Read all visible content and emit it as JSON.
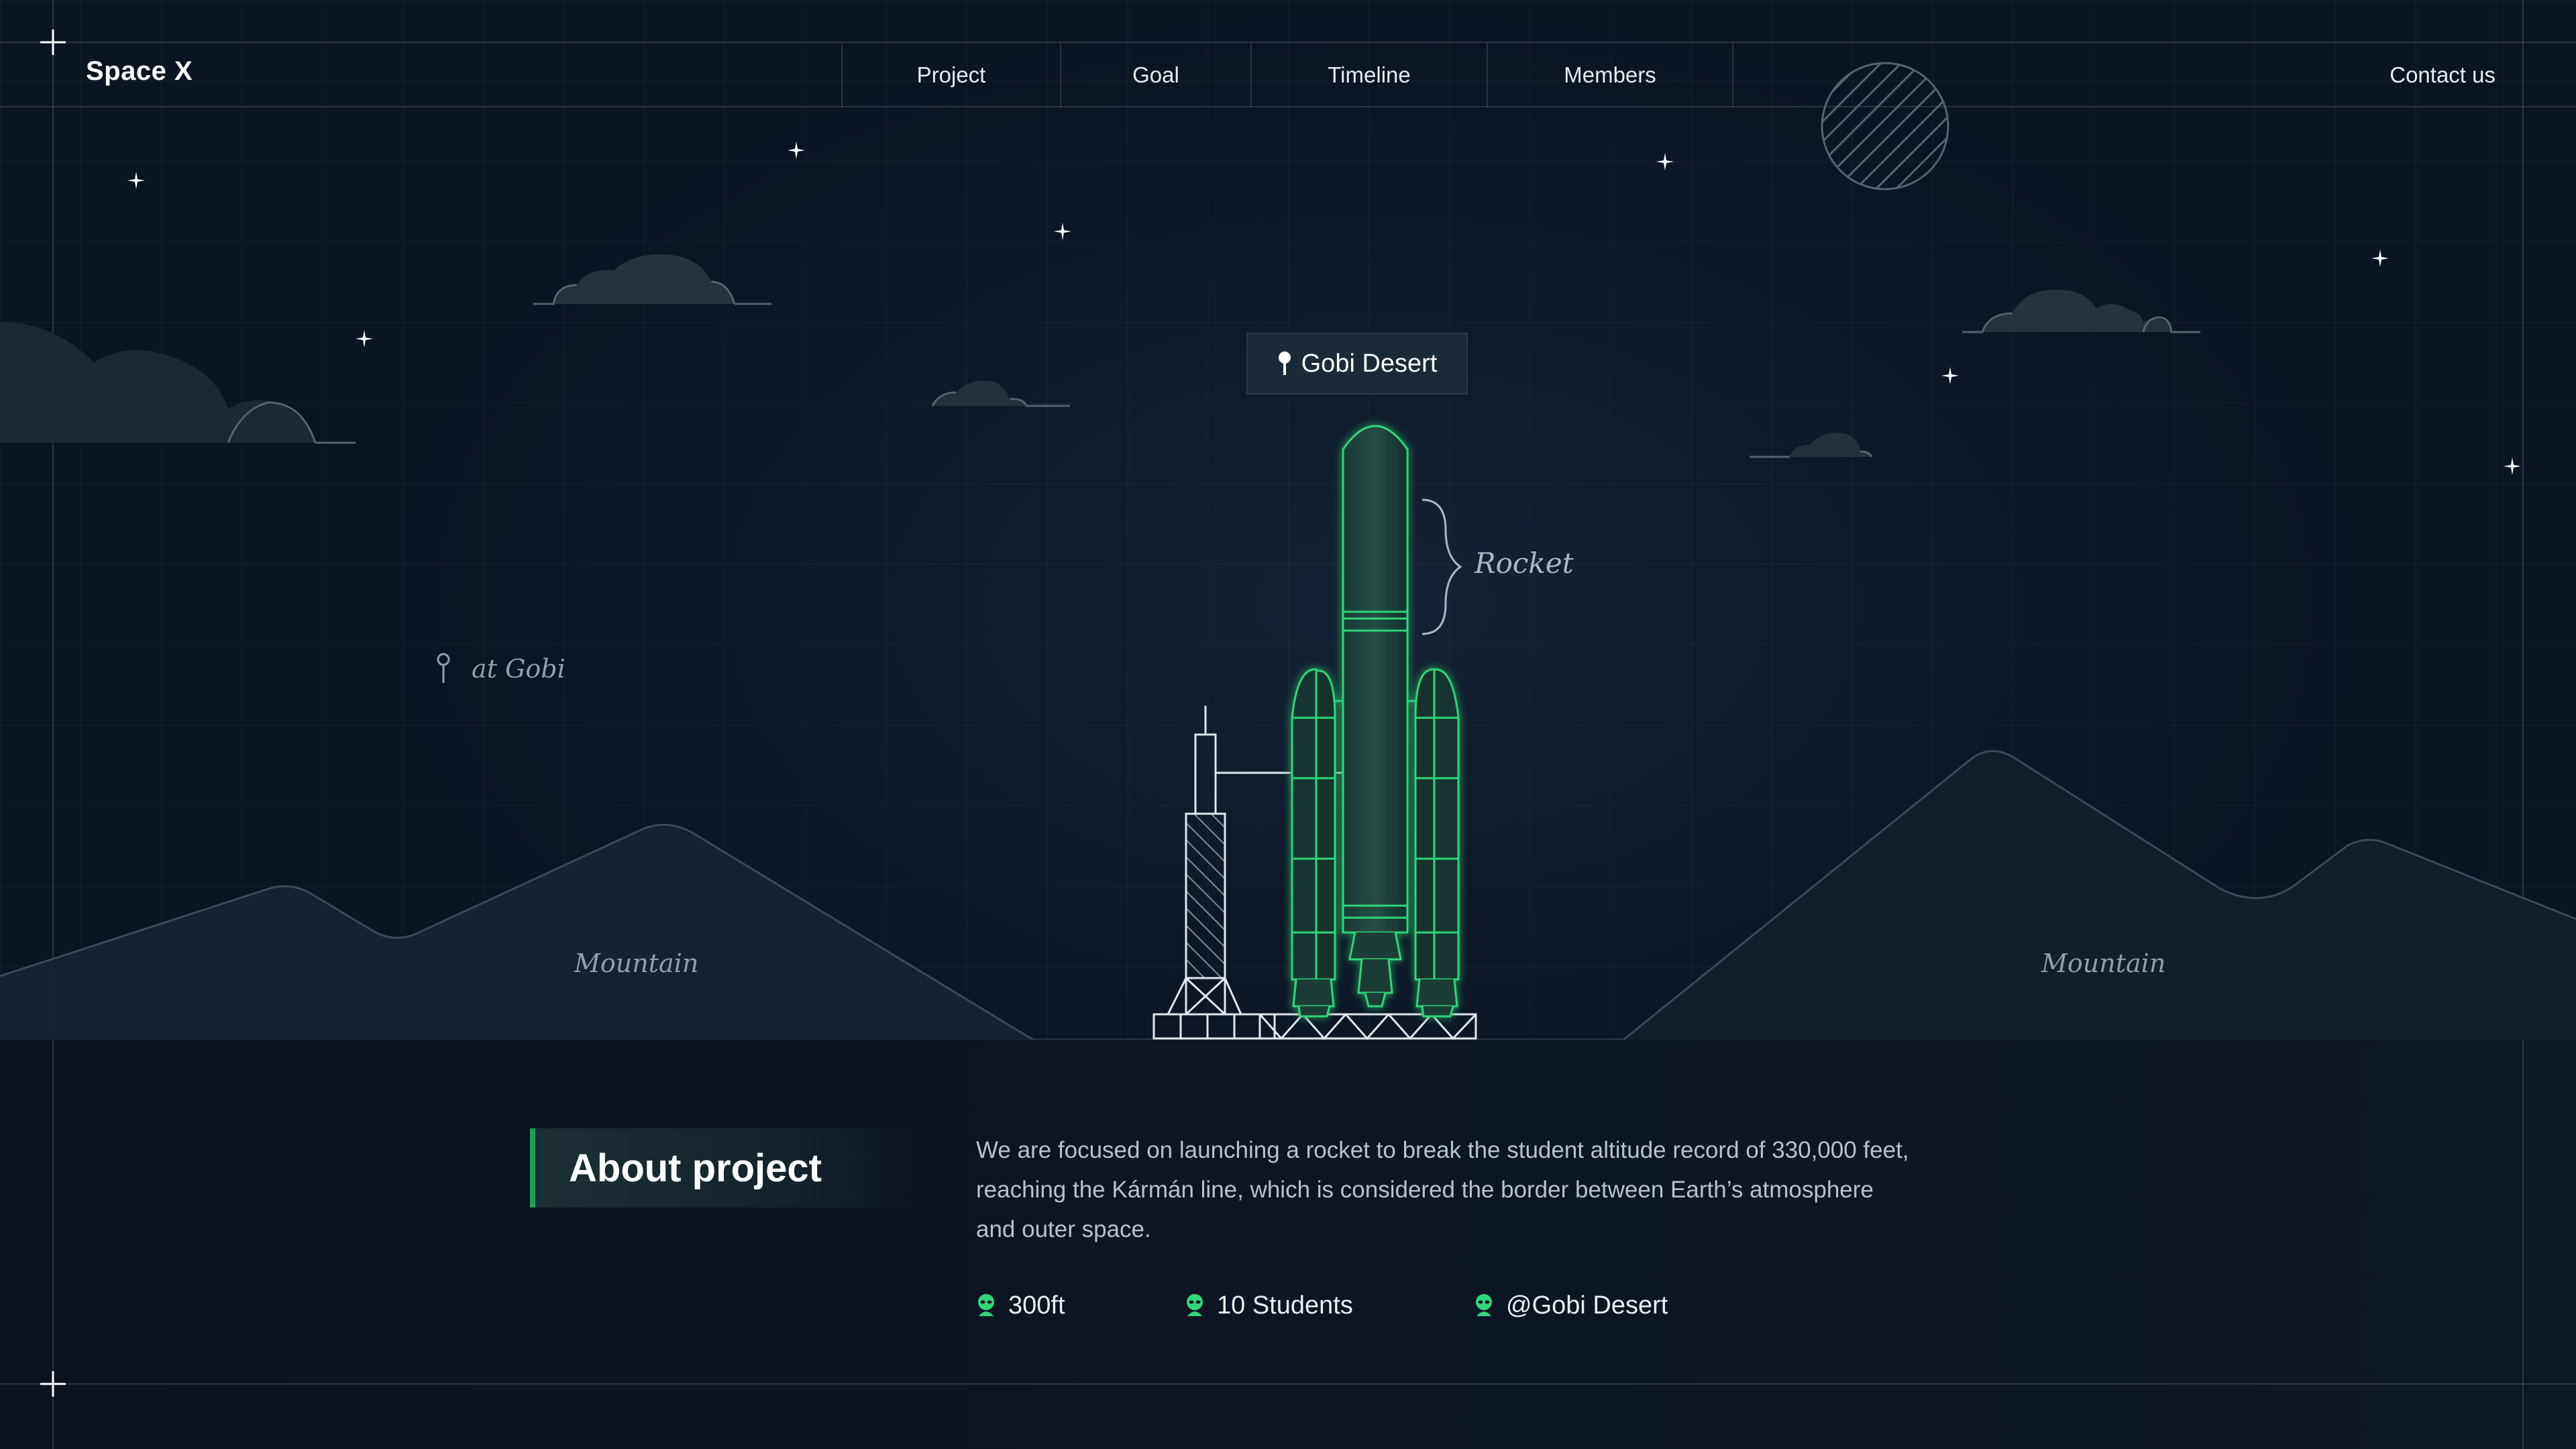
{
  "nav": {
    "brand": "Space X",
    "items": [
      {
        "label": "Project"
      },
      {
        "label": "Goal"
      },
      {
        "label": "Timeline"
      },
      {
        "label": "Members"
      }
    ],
    "contact": "Contact us"
  },
  "scene": {
    "location_chip": "Gobi Desert",
    "rocket_label": "Rocket",
    "location_note": "at Gobi",
    "mountain_left": "Mountain",
    "mountain_right": "Mountain"
  },
  "about": {
    "title": "About project",
    "lines": [
      "We are focused on launching a rocket to break the student altitude record of 330,000 feet,",
      "reaching the Kármán line, which is considered the border between Earth’s atmosphere",
      "and outer space."
    ],
    "stats": [
      {
        "label": "300ft"
      },
      {
        "label": "10 Students"
      },
      {
        "label": "@Gobi Desert"
      }
    ]
  },
  "colors": {
    "background": "#0c1523",
    "accent_green": "#2fd67a",
    "line": "#3b4a57"
  },
  "icons": {
    "stat": "alien-icon",
    "chip": "location-pin-icon",
    "moon": "moon-icon"
  }
}
